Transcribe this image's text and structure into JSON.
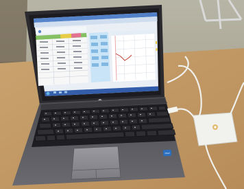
{
  "photo": {
    "subject": "laptop-on-desk",
    "laptop_logo": "hp",
    "sticker_text": "intel"
  },
  "screen": {
    "taskbar_color": "#2f5aa8",
    "window_frame_color": "#4a7bc6",
    "chart_line_color": "#c0392b",
    "panel_accent_colors": [
      "#7dbd5a",
      "#e8c93a",
      "#7db5e0",
      "#e06a8a",
      "#c6e3f6"
    ]
  }
}
